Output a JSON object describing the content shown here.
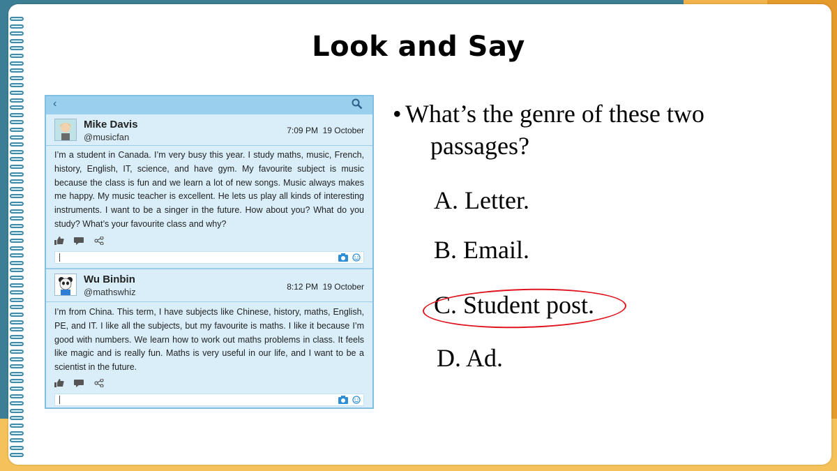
{
  "slide": {
    "title": "Look and Say"
  },
  "posts": [
    {
      "name": "Mike Davis",
      "handle": "@musicfan",
      "time": "7:09 PM",
      "date": "19 October",
      "text": "I’m a student in Canada. I’m very busy this year. I study maths, music, French, history, English, IT, science, and have gym. My favourite subject is music because the class is fun and we learn a lot of new songs. Music always makes me happy. My music teacher is excellent. He lets us play all kinds of interesting instruments. I want to be a singer in the future. How about you? What do you study? What’s your favourite class and why?"
    },
    {
      "name": "Wu Binbin",
      "handle": "@mathswhiz",
      "time": "8:12 PM",
      "date": "19 October",
      "text": "I’m from China. This term, I have subjects like Chinese, history, maths, English, PE, and IT. I like all the subjects, but my favourite is maths. I like it because I’m good with numbers. We learn how to work out maths problems in class. It feels like magic and is really fun. Maths is very useful in our life, and I want to be a scientist in the future."
    }
  ],
  "question": {
    "bullet": "•",
    "line1": "What’s the genre of these two",
    "line2": "passages?",
    "options": [
      {
        "label": "A. Letter."
      },
      {
        "label": "B. Email."
      },
      {
        "label": "C. Student post.",
        "circled": true
      },
      {
        "label": "D. Ad."
      }
    ]
  },
  "colors": {
    "panel_bg": "#d9eef9",
    "panel_header": "#9ad0ee",
    "circle": "#e0141e"
  },
  "icons": [
    "back-arrow-icon",
    "search-icon",
    "avatar-icon",
    "like-icon",
    "comment-icon",
    "share-icon",
    "camera-icon",
    "smiley-icon"
  ]
}
